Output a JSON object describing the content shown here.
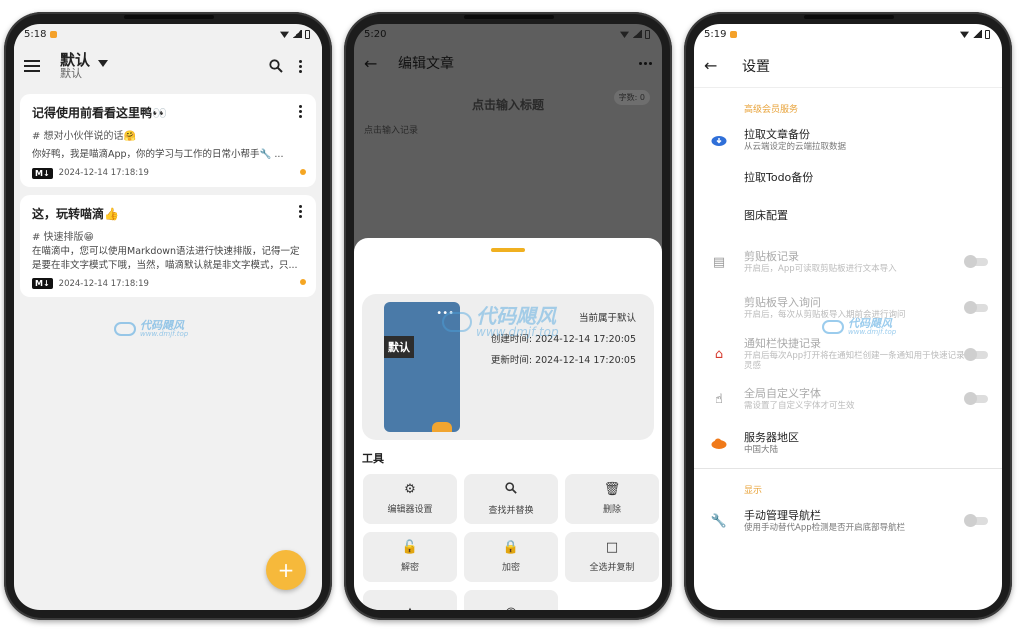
{
  "phone1": {
    "status_time": "5:18",
    "header": {
      "title": "默认",
      "subtitle": "默认"
    },
    "notes": [
      {
        "title": "记得使用前看看这里鸭👀",
        "tag": "# 想对小伙伴说的话🤗",
        "body": "你好鸭，我是喵滴App，你的学习与工作的日常小帮手🔧 ...",
        "date": "2024-12-14 17:18:19",
        "badge": "M↓"
      },
      {
        "title": "这，玩转喵滴👍",
        "tag": "# 快速排版😁",
        "body": "在喵滴中，您可以使用Markdown语法进行快速排版，记得一定是要在非文字模式下哦，当然，喵滴默认就是非文字模式，只...",
        "date": "2024-12-14 17:18:19",
        "badge": "M↓"
      }
    ],
    "fab": "+",
    "watermark": {
      "brand": "代码飓风",
      "url": "www.dmjf.top"
    }
  },
  "phone2": {
    "status_time": "5:20",
    "header": {
      "title": "编辑文章"
    },
    "word_count": "字数: 0",
    "title_placeholder": "点击输入标题",
    "body_placeholder": "点击输入记录",
    "cover_label": "默认",
    "meta": {
      "line1": "当前属于默认",
      "created": "创建时间: 2024-12-14 17:20:05",
      "updated": "更新时间: 2024-12-14 17:20:05"
    },
    "tools_title": "工具",
    "tools": [
      {
        "label": "编辑器设置",
        "icon": "gear-icon"
      },
      {
        "label": "查找并替换",
        "icon": "search-icon"
      },
      {
        "label": "删除",
        "icon": "trash-icon"
      },
      {
        "label": "解密",
        "icon": "unlock-icon"
      },
      {
        "label": "加密",
        "icon": "lock-icon"
      },
      {
        "label": "全选并复制",
        "icon": "select-all-icon"
      },
      {
        "label": "",
        "icon": "brush-icon"
      },
      {
        "label": "",
        "icon": "eye-icon"
      }
    ],
    "watermark": {
      "brand": "代码飓风",
      "url": "www.dmjf.top"
    }
  },
  "phone3": {
    "status_time": "5:19",
    "header": {
      "title": "设置"
    },
    "section1": "高级会员服务",
    "items": [
      {
        "title": "拉取文章备份",
        "sub": "从云端设定的云端拉取数据",
        "icon": "cloud-download-icon",
        "color": "#2f6fd8"
      },
      {
        "title": "拉取Todo备份",
        "sub": "",
        "icon": "",
        "color": ""
      },
      {
        "title": "图床配置",
        "sub": "",
        "icon": "",
        "color": ""
      },
      {
        "title": "剪贴板记录",
        "sub": "开启后，App可读取剪贴板进行文本导入",
        "icon": "clipboard-icon",
        "color": "#999999"
      },
      {
        "title": "剪贴板导入询问",
        "sub": "开启后，每次从剪贴板导入期前会进行询问",
        "icon": "",
        "color": ""
      },
      {
        "title": "通知栏快捷记录",
        "sub": "开启后每次App打开将在通知栏创建一条通知用于快速记录灵感",
        "icon": "home-icon",
        "color": "#d63b2f"
      },
      {
        "title": "全局自定义字体",
        "sub": "需设置了自定义字体才可生效",
        "icon": "touch-icon",
        "color": "#333333"
      },
      {
        "title": "服务器地区",
        "sub": "中国大陆",
        "icon": "cloud-icon",
        "color": "#f07a1a"
      }
    ],
    "section2": "显示",
    "nav_item": {
      "title": "手动管理导航栏",
      "sub": "使用手动替代App检测是否开启底部导航栏",
      "icon": "wrench-icon"
    },
    "watermark": {
      "brand": "代码飓风",
      "url": "www.dmjf.top"
    }
  }
}
